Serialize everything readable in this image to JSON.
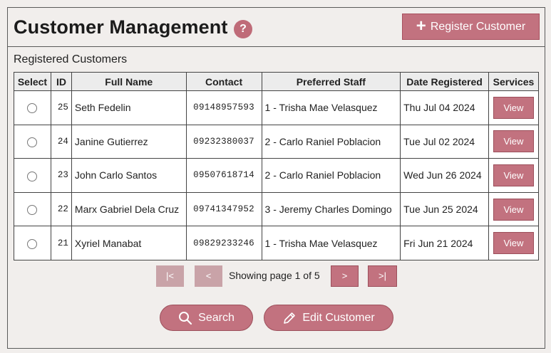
{
  "header": {
    "title": "Customer Management",
    "help_glyph": "?",
    "register_label": "Register Customer",
    "register_icon": "plus-icon"
  },
  "section_label": "Registered Customers",
  "table": {
    "columns": [
      "Select",
      "ID",
      "Full Name",
      "Contact",
      "Preferred Staff",
      "Date Registered",
      "Services"
    ],
    "rows": [
      {
        "id": "25",
        "name": "Seth Fedelin",
        "contact": "09148957593",
        "staff": "1 - Trisha Mae Velasquez",
        "date": "Thu Jul 04 2024",
        "action": "View"
      },
      {
        "id": "24",
        "name": "Janine Gutierrez",
        "contact": "09232380037",
        "staff": "2 - Carlo Raniel Poblacion",
        "date": "Tue Jul 02 2024",
        "action": "View"
      },
      {
        "id": "23",
        "name": "John Carlo Santos",
        "contact": "09507618714",
        "staff": "2 - Carlo Raniel Poblacion",
        "date": "Wed Jun 26 2024",
        "action": "View"
      },
      {
        "id": "22",
        "name": "Marx Gabriel Dela Cruz",
        "contact": "09741347952",
        "staff": "3 - Jeremy Charles Domingo",
        "date": "Tue Jun 25 2024",
        "action": "View"
      },
      {
        "id": "21",
        "name": "Xyriel Manabat",
        "contact": "09829233246",
        "staff": "1 - Trisha Mae Velasquez",
        "date": "Fri Jun 21 2024",
        "action": "View"
      }
    ]
  },
  "pagination": {
    "first": "|<",
    "prev": "<",
    "info": "Showing page 1 of 5",
    "next": ">",
    "last": ">|"
  },
  "actions": {
    "search_label": "Search",
    "search_icon": "search-icon",
    "edit_label": "Edit Customer",
    "edit_icon": "pencil-icon"
  },
  "colors": {
    "accent": "#c2727f",
    "accent_disabled": "#c9a3a8",
    "background": "#f1eeec"
  }
}
